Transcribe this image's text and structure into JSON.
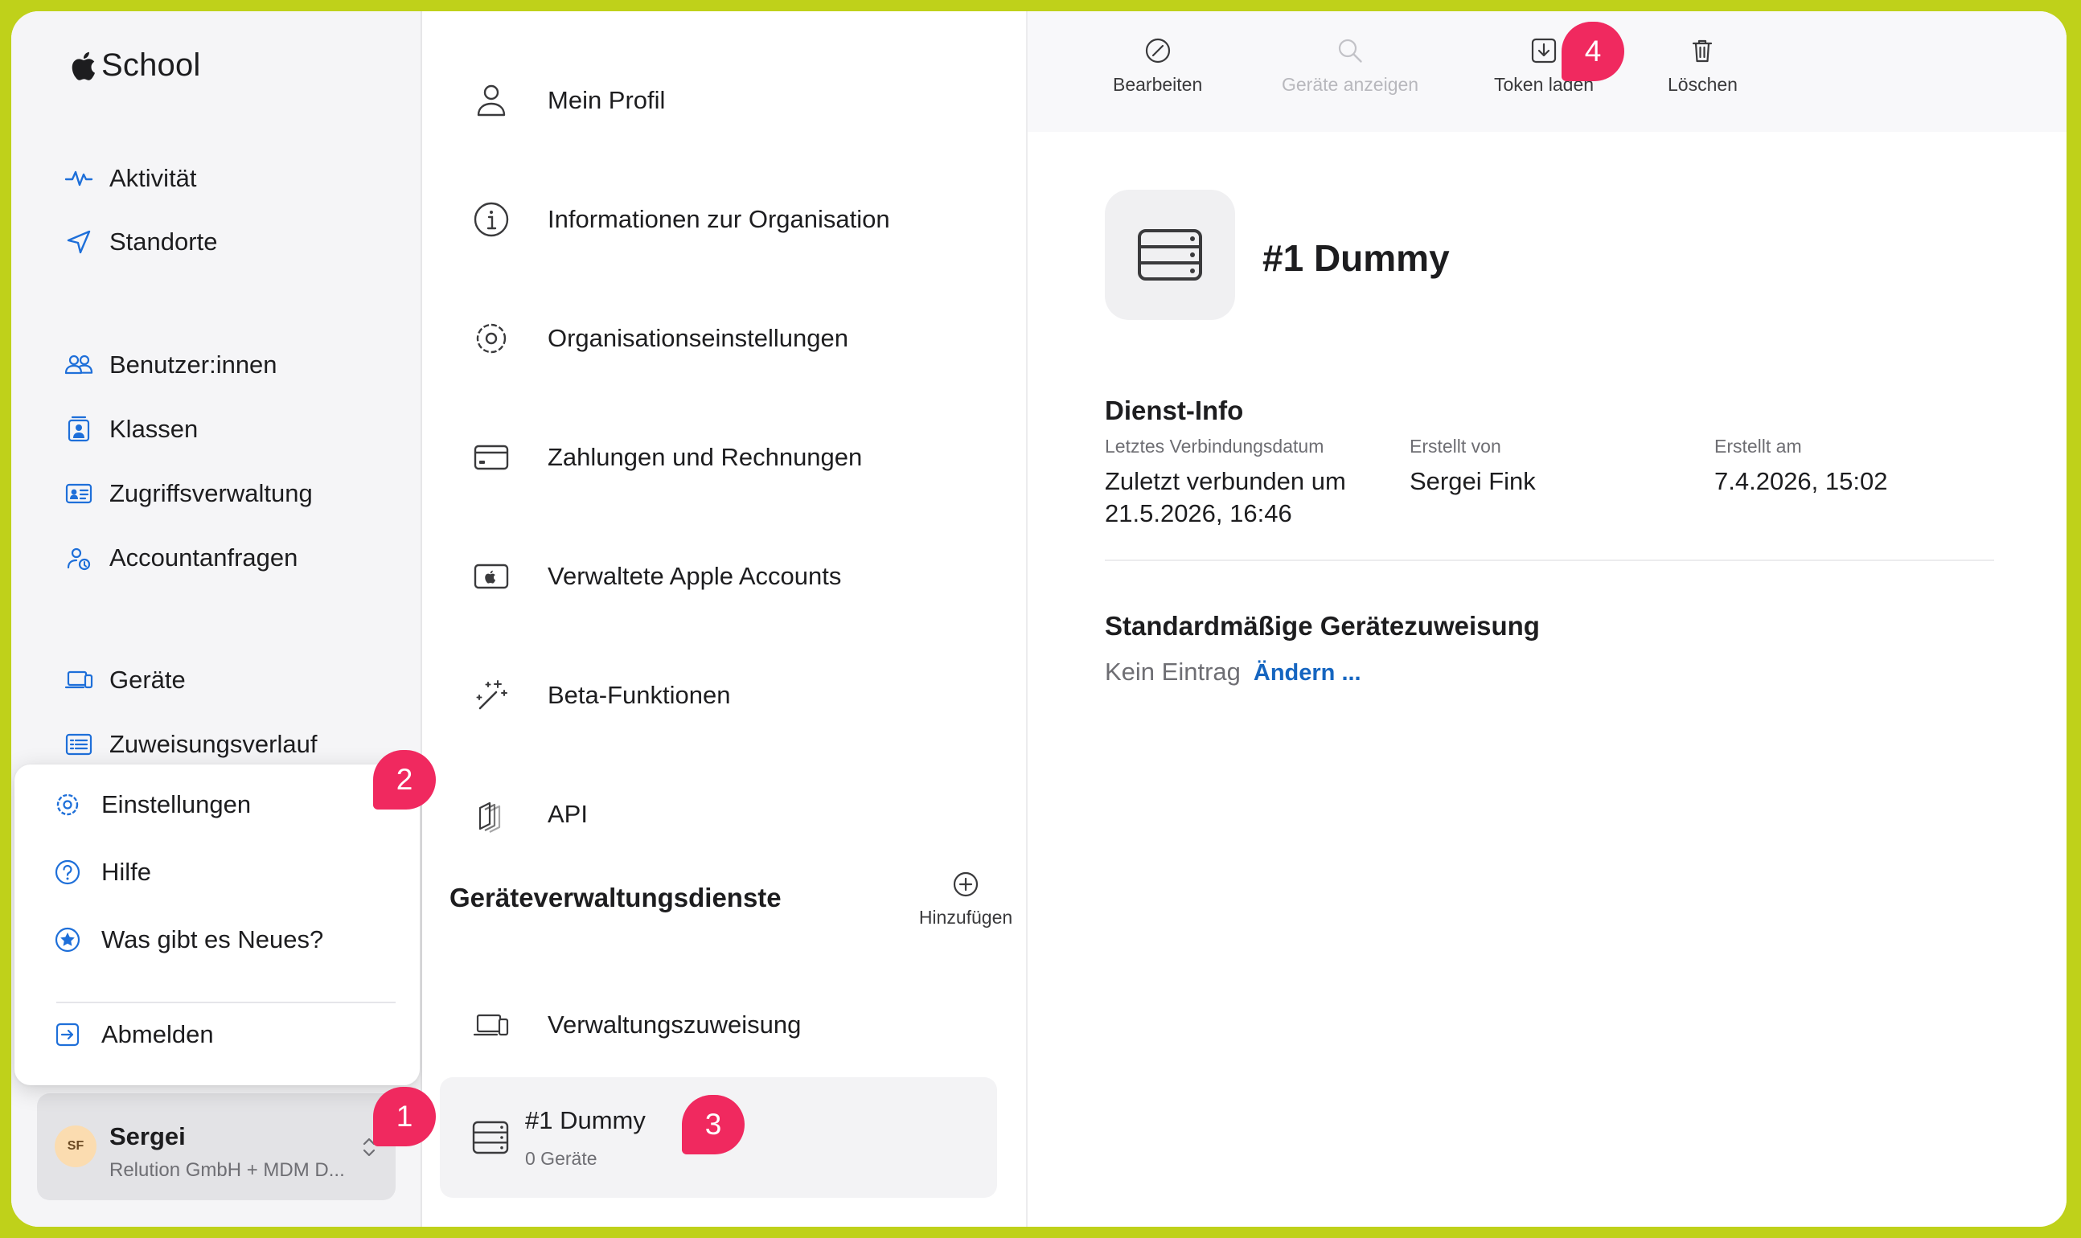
{
  "app": {
    "title": "School"
  },
  "sidebar": {
    "items": [
      {
        "label": "Aktivität",
        "icon": "activity-icon"
      },
      {
        "label": "Standorte",
        "icon": "location-icon"
      },
      {
        "label": "Benutzer:innen",
        "icon": "users-icon"
      },
      {
        "label": "Klassen",
        "icon": "classes-icon"
      },
      {
        "label": "Zugriffsverwaltung",
        "icon": "id-card-icon"
      },
      {
        "label": "Accountanfragen",
        "icon": "account-request-icon"
      },
      {
        "label": "Geräte",
        "icon": "devices-icon"
      },
      {
        "label": "Zuweisungsverlauf",
        "icon": "list-icon"
      }
    ]
  },
  "popover": {
    "items": [
      {
        "label": "Einstellungen",
        "icon": "gear-icon"
      },
      {
        "label": "Hilfe",
        "icon": "help-icon"
      },
      {
        "label": "Was gibt es Neues?",
        "icon": "star-icon"
      },
      {
        "label": "Abmelden",
        "icon": "logout-icon"
      }
    ]
  },
  "account": {
    "initials": "SF",
    "name": "Sergei",
    "org": "Relution GmbH + MDM D..."
  },
  "middle": {
    "items": [
      {
        "label": "Mein Profil",
        "icon": "person-icon"
      },
      {
        "label": "Informationen zur Organisation",
        "icon": "info-icon"
      },
      {
        "label": "Organisationseinstellungen",
        "icon": "gear-icon"
      },
      {
        "label": "Zahlungen und Rechnungen",
        "icon": "credit-card-icon"
      },
      {
        "label": "Verwaltete Apple Accounts",
        "icon": "apple-card-icon"
      },
      {
        "label": "Beta-Funktionen",
        "icon": "magic-wand-icon"
      },
      {
        "label": "API",
        "icon": "api-icon"
      }
    ],
    "section_title": "Geräteverwaltungsdienste",
    "add_label": "Hinzufügen",
    "assignment_label": "Verwaltungszuweisung",
    "selected": {
      "title": "#1 Dummy",
      "subtitle": "0 Geräte"
    }
  },
  "toolbar": {
    "edit": "Bearbeiten",
    "show_devices": "Geräte anzeigen",
    "download_token": "Token laden",
    "delete": "Löschen"
  },
  "detail": {
    "title": "#1 Dummy",
    "service_info_heading": "Dienst-Info",
    "last_connection_label": "Letztes Verbindungsdatum",
    "last_connection_value": "Zuletzt verbunden um 21.5.2026, 16:46",
    "created_by_label": "Erstellt von",
    "created_by_value": "Sergei Fink",
    "created_at_label": "Erstellt am",
    "created_at_value": "7.4.2026, 15:02",
    "default_assignment_heading": "Standardmäßige Gerätezuweisung",
    "default_assignment_value": "Kein Eintrag",
    "change_link": "Ändern ..."
  },
  "badges": [
    "1",
    "2",
    "3",
    "4"
  ],
  "colors": {
    "accent_blue": "#1565c0",
    "badge": "#f0295f",
    "frame": "#bfd11a"
  }
}
